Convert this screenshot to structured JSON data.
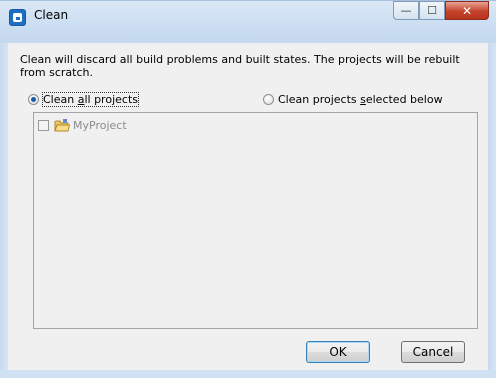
{
  "window": {
    "title": "Clean",
    "icon": "app-icon",
    "minimize_glyph": "—",
    "maximize_glyph": "☐",
    "close_glyph": "✕"
  },
  "description": "Clean will discard all build problems and built states.  The projects will be rebuilt from scratch.",
  "options": {
    "clean_all": {
      "label_prefix": "Clean ",
      "mnemonic": "a",
      "label_suffix": "ll projects",
      "selected": true
    },
    "clean_selected": {
      "label_prefix": "Clean projects ",
      "mnemonic": "s",
      "label_suffix": "elected below",
      "selected": false
    }
  },
  "projects": [
    {
      "name": "MyProject",
      "checked": false,
      "enabled": false
    }
  ],
  "buttons": {
    "ok": "OK",
    "cancel": "Cancel"
  },
  "colors": {
    "accent": "#3c7fb1",
    "disabled_text": "#8c8c8c"
  }
}
